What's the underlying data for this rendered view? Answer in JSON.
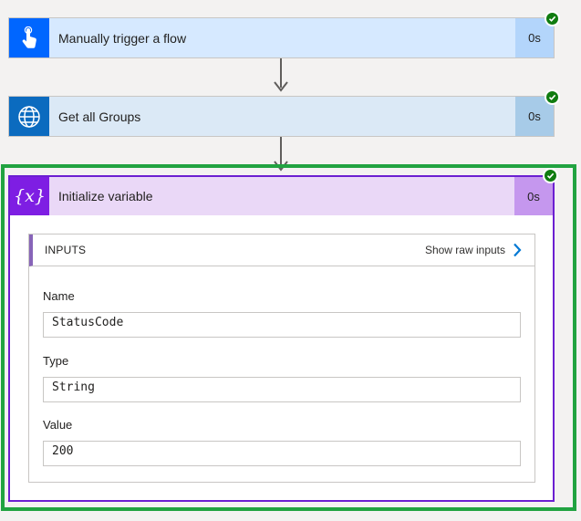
{
  "steps": [
    {
      "title": "Manually trigger a flow",
      "duration": "0s",
      "icon": "touch-hand-icon",
      "status": "succeeded"
    },
    {
      "title": "Get all Groups",
      "duration": "0s",
      "icon": "globe-icon",
      "status": "succeeded"
    }
  ],
  "variable_step": {
    "title": "Initialize variable",
    "duration": "0s",
    "icon": "variable-braces-icon",
    "icon_text": "{x}",
    "status": "succeeded",
    "inputs": {
      "heading": "INPUTS",
      "raw_link": "Show raw inputs",
      "fields": [
        {
          "label": "Name",
          "value": "StatusCode"
        },
        {
          "label": "Type",
          "value": "String"
        },
        {
          "label": "Value",
          "value": "200"
        }
      ]
    }
  },
  "colors": {
    "success": "#107c10",
    "highlight_frame": "#21a341",
    "variable_accent": "#7e1ee3"
  }
}
